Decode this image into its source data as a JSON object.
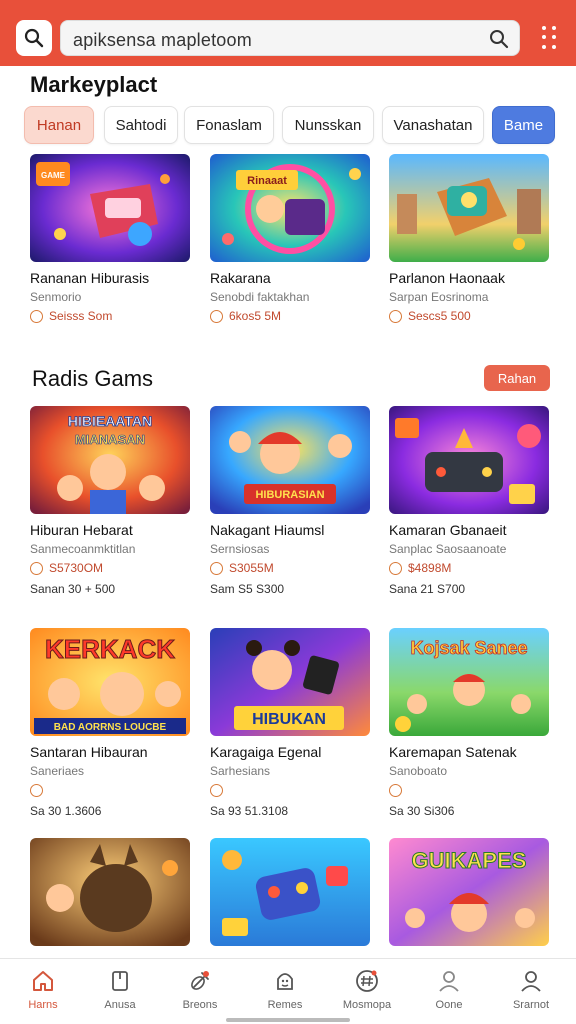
{
  "header": {
    "search_value": "apiksensa mapletoom"
  },
  "marketplace": {
    "title": "Markeyplact",
    "tabs": [
      "Hanan",
      "Sahtodi",
      "Fonaslam",
      "Nunsskan",
      "Vanashatan",
      "Bame"
    ]
  },
  "row1": [
    {
      "title": "Rananan Hiburasis",
      "sub": "Senmorio",
      "price": "Seisss Som"
    },
    {
      "title": "Rakarana",
      "sub": "Senobdi faktakhan",
      "price": "6kos5 5M"
    },
    {
      "title": "Parlanon Haonaak",
      "sub": "Sarpan Eosrinoma",
      "price": "Sescs5 500"
    }
  ],
  "radis": {
    "title": "Radis Gams",
    "button_label": "Rahan"
  },
  "row2": [
    {
      "title": "Hiburan Hebarat",
      "sub": "Sanmecoanmktitlan",
      "price": "S5730OM",
      "extra": "Sanan 30 + 500"
    },
    {
      "title": "Nakagant Hiaumsl",
      "sub": "Sernsiosas",
      "price": "S3055M",
      "extra": "Sam  S5  S300"
    },
    {
      "title": "Kamaran Gbanaeit",
      "sub": "Sanplac Saosaanoate",
      "price": "$4898M",
      "extra": "Sana  21  S700"
    }
  ],
  "row3": [
    {
      "title": "Santaran Hibauran",
      "sub": "Saneriaes",
      "price": "",
      "extra": "Sa 30  1.3606"
    },
    {
      "title": "Karagaiga Egenal",
      "sub": "Sarhesians",
      "price": "",
      "extra": "Sa  93  51.3108"
    },
    {
      "title": "Karemapan Satenak",
      "sub": "Sanoboato",
      "price": "",
      "extra": "Sa  30  Si306"
    }
  ],
  "thumb_texts": {
    "r1c1": "GAME",
    "r1c2": "Rinaaat",
    "r2c1_top": "HIBIEAATAN",
    "r2c1_bot": "MIANASAN",
    "r2c2": "HIBURASIAN",
    "r3c1_top": "KERKACK",
    "r3c1_bot": "BAD AORRNS LOUCBE",
    "r3c2": "HIBUKAN",
    "r3c3": "Kojsak Sanee",
    "r4c3": "GUIKAPES"
  },
  "bottom_nav": [
    {
      "label": "Harns",
      "icon": "home-icon"
    },
    {
      "label": "Anusa",
      "icon": "book-icon"
    },
    {
      "label": "Breons",
      "icon": "pin-icon"
    },
    {
      "label": "Remes",
      "icon": "face-icon"
    },
    {
      "label": "Mosmopa",
      "icon": "hash-icon"
    },
    {
      "label": "Oone",
      "icon": "user-icon"
    },
    {
      "label": "Srarnot",
      "icon": "profile-icon"
    }
  ],
  "colors": {
    "accent": "#e8503a",
    "tab_active_bg": "#fbd9cf",
    "tab_blue": "#4e7be0",
    "price_red": "#c14a2e"
  }
}
